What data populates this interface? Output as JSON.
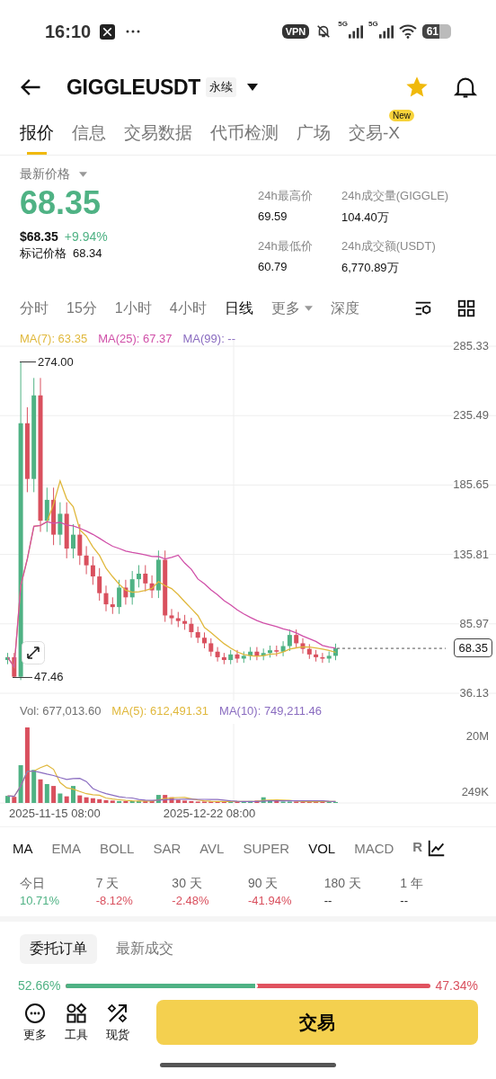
{
  "status_bar": {
    "time": "16:10",
    "vpn": "VPN",
    "network_1": "5G",
    "network_2": "5G",
    "battery": "61"
  },
  "header": {
    "symbol": "GIGGLEUSDT",
    "contract_tag": "永续"
  },
  "tabs": [
    {
      "label": "报价",
      "selected": true
    },
    {
      "label": "信息",
      "selected": false
    },
    {
      "label": "交易数据",
      "selected": false
    },
    {
      "label": "代币检测",
      "selected": false
    },
    {
      "label": "广场",
      "selected": false
    },
    {
      "label": "交易-X",
      "selected": false,
      "badge": "New"
    }
  ],
  "price": {
    "label": "最新价格",
    "last": "68.35",
    "usd": "$68.35",
    "change": "+9.94%",
    "mark_label": "标记价格",
    "mark": "68.34"
  },
  "stats": [
    {
      "label": "24h最高价",
      "value": "69.59"
    },
    {
      "label": "24h成交量(GIGGLE)",
      "value": "104.40万"
    },
    {
      "label": "24h最低价",
      "value": "60.79"
    },
    {
      "label": "24h成交额(USDT)",
      "value": "6,770.89万"
    }
  ],
  "intervals": [
    {
      "label": "分时",
      "selected": false,
      "kind": "plain"
    },
    {
      "label": "15分",
      "selected": false,
      "kind": "plain"
    },
    {
      "label": "1小时",
      "selected": false,
      "kind": "plain"
    },
    {
      "label": "4小时",
      "selected": false,
      "kind": "plain"
    },
    {
      "label": "日线",
      "selected": true,
      "kind": "plain"
    },
    {
      "label": "更多",
      "selected": false,
      "kind": "dropdown"
    },
    {
      "label": "深度",
      "selected": false,
      "kind": "plain"
    }
  ],
  "chart": {
    "legend": [
      {
        "label": "MA(7): 63.35",
        "color": "#e0b83c"
      },
      {
        "label": "MA(25): 67.37",
        "color": "#d04fa8"
      },
      {
        "label": "MA(99): --",
        "color": "#8a6cc0"
      }
    ],
    "y_axis": [
      "285.33",
      "235.49",
      "185.65",
      "135.81",
      "85.97",
      "36.13"
    ],
    "high": "274.00",
    "low": "47.46",
    "current": "68.35"
  },
  "volume": {
    "legend": [
      {
        "label": "Vol: 677,013.60",
        "color": "#707070"
      },
      {
        "label": "MA(5): 612,491.31",
        "color": "#e0b83c"
      },
      {
        "label": "MA(10): 749,211.46",
        "color": "#8a6cc0"
      }
    ],
    "y_axis": [
      "20M",
      "249K"
    ],
    "dates": [
      "2025-11-15 08:00",
      "2025-12-22 08:00"
    ]
  },
  "indicators": [
    {
      "label": "MA",
      "selected": true
    },
    {
      "label": "EMA",
      "selected": false
    },
    {
      "label": "BOLL",
      "selected": false
    },
    {
      "label": "SAR",
      "selected": false
    },
    {
      "label": "AVL",
      "selected": false
    },
    {
      "label": "SUPER",
      "selected": false
    },
    {
      "label": "VOL",
      "selected": true
    },
    {
      "label": "MACD",
      "selected": false
    },
    {
      "label": "R",
      "selected": false
    }
  ],
  "returns": [
    {
      "period": "今日",
      "value": "10.71%",
      "color": "#4fb284"
    },
    {
      "period": "7 天",
      "value": "-8.12%",
      "color": "#d9505e"
    },
    {
      "period": "30 天",
      "value": "-2.48%",
      "color": "#d9505e"
    },
    {
      "period": "90 天",
      "value": "-41.94%",
      "color": "#d9505e"
    },
    {
      "period": "180 天",
      "value": "--"
    },
    {
      "period": "1 年",
      "value": "--"
    }
  ],
  "order_tabs": [
    {
      "label": "委托订单",
      "selected": true
    },
    {
      "label": "最新成交",
      "selected": false
    }
  ],
  "ratio": {
    "buy": "52.66%",
    "sell": "47.34%",
    "level": 0.5266
  },
  "bottom_nav": [
    {
      "label": "更多"
    },
    {
      "label": "工具"
    },
    {
      "label": "现货"
    }
  ],
  "trade_button": "交易"
}
